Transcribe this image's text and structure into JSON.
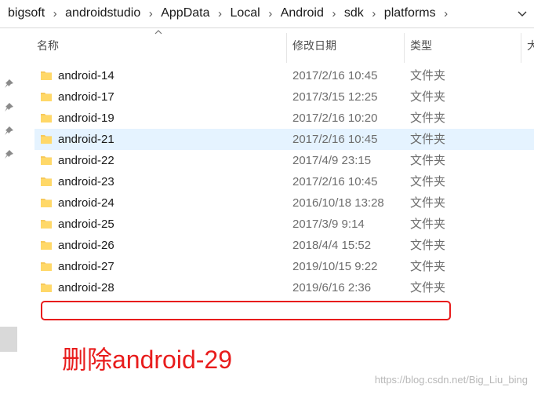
{
  "address_bar": {
    "crumbs": [
      "bigsoft",
      "androidstudio",
      "AppData",
      "Local",
      "Android",
      "sdk",
      "platforms"
    ],
    "separator": "›"
  },
  "columns": {
    "name": "名称",
    "date_modified": "修改日期",
    "type": "类型",
    "size": "大"
  },
  "files": [
    {
      "name": "android-14",
      "date": "2017/2/16 10:45",
      "type": "文件夹",
      "selected": false
    },
    {
      "name": "android-17",
      "date": "2017/3/15 12:25",
      "type": "文件夹",
      "selected": false
    },
    {
      "name": "android-19",
      "date": "2017/2/16 10:20",
      "type": "文件夹",
      "selected": false
    },
    {
      "name": "android-21",
      "date": "2017/2/16 10:45",
      "type": "文件夹",
      "selected": true
    },
    {
      "name": "android-22",
      "date": "2017/4/9 23:15",
      "type": "文件夹",
      "selected": false
    },
    {
      "name": "android-23",
      "date": "2017/2/16 10:45",
      "type": "文件夹",
      "selected": false
    },
    {
      "name": "android-24",
      "date": "2016/10/18 13:28",
      "type": "文件夹",
      "selected": false
    },
    {
      "name": "android-25",
      "date": "2017/3/9 9:14",
      "type": "文件夹",
      "selected": false
    },
    {
      "name": "android-26",
      "date": "2018/4/4 15:52",
      "type": "文件夹",
      "selected": false
    },
    {
      "name": "android-27",
      "date": "2019/10/15 9:22",
      "type": "文件夹",
      "selected": false
    },
    {
      "name": "android-28",
      "date": "2019/6/16 2:36",
      "type": "文件夹",
      "selected": false
    }
  ],
  "annotation": {
    "text": "删除android-29",
    "color": "#e81c1c"
  },
  "watermark": "https://blog.csdn.net/Big_Liu_bing",
  "colors": {
    "folder": "#f7c95b",
    "selected_row": "#e5f3ff",
    "pin": "#8a8a8a"
  },
  "icons": {
    "address_dropdown": "chevron-down-icon",
    "sort": "sort-up-icon",
    "folder": "folder-icon",
    "pin": "pin-icon"
  }
}
